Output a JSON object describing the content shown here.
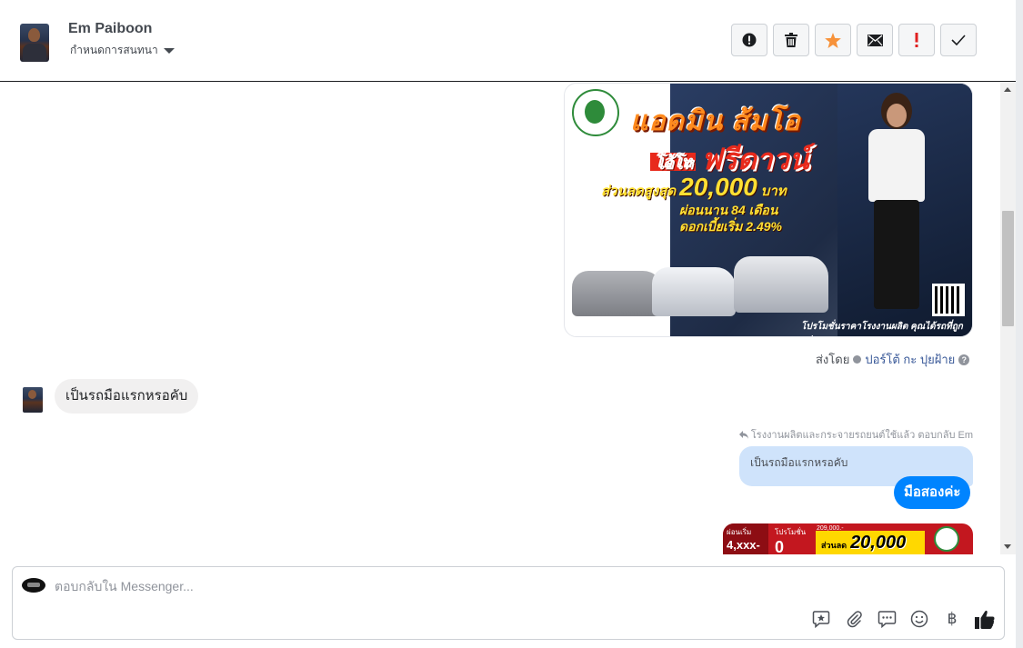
{
  "header": {
    "contact_name": "Em Paiboon",
    "assign_label": "กำหนดการสนทนา",
    "toolbar": [
      {
        "name": "report-spam-button",
        "icon": "alert-circle-icon"
      },
      {
        "name": "delete-button",
        "icon": "trash-icon"
      },
      {
        "name": "star-button",
        "icon": "star-icon"
      },
      {
        "name": "mark-unread-button",
        "icon": "envelope-icon"
      },
      {
        "name": "follow-up-button",
        "icon": "exclamation-icon"
      },
      {
        "name": "mark-done-button",
        "icon": "check-icon"
      }
    ]
  },
  "messages": {
    "ad1": {
      "line1": "แอดมิน",
      "line1b": "ส้มโอ",
      "line2_prefix": "โอ้โห",
      "line2": "ฟรีดาวน์",
      "line3_prefix": "ส่วนลดสูงสุด",
      "line3_amount": "20,000",
      "line3_unit": "บาท",
      "line4": "ผ่อนนาน 84 เดือน",
      "line5": "ดอกเบี้ยเริ่ม 2.49%",
      "caption": "โปรโมชั่นราคาโรงงานผลิต คุณได้รถที่ถูกกว่า"
    },
    "sent_by_label": "ส่งโดย",
    "sent_by_name": "ปอร์โต้ กะ ปุยฝ้าย",
    "sent_by_help": "?",
    "incoming_text": "เป็นรถมือแรกหรอคับ",
    "reply_note": "โรงงานผลิตและกระจายรถยนต์ใช้แล้ว ตอบกลับ Em",
    "quoted_text": "เป็นรถมือแรกหรอคับ",
    "outgoing_text": "มือสองค่ะ",
    "ad2": {
      "p1_label": "ผ่อนเริ่ม",
      "p1_value": "4,xxx-",
      "p2_label": "โปรโมชั่น",
      "p2_value": "0",
      "p3_small": "ส่วนลด",
      "p3_amount": "20,000",
      "p4": "209,000.-"
    }
  },
  "composer": {
    "placeholder": "ตอบกลับใน Messenger...",
    "icons": [
      "saved-reply-icon",
      "attachment-icon",
      "quick-reply-icon",
      "emoji-icon",
      "baht-payment-icon",
      "thumbs-up-icon"
    ],
    "baht_symbol": "฿"
  },
  "colors": {
    "accent": "#0084ff",
    "star": "#f7923a",
    "follow_up": "#e02020"
  }
}
